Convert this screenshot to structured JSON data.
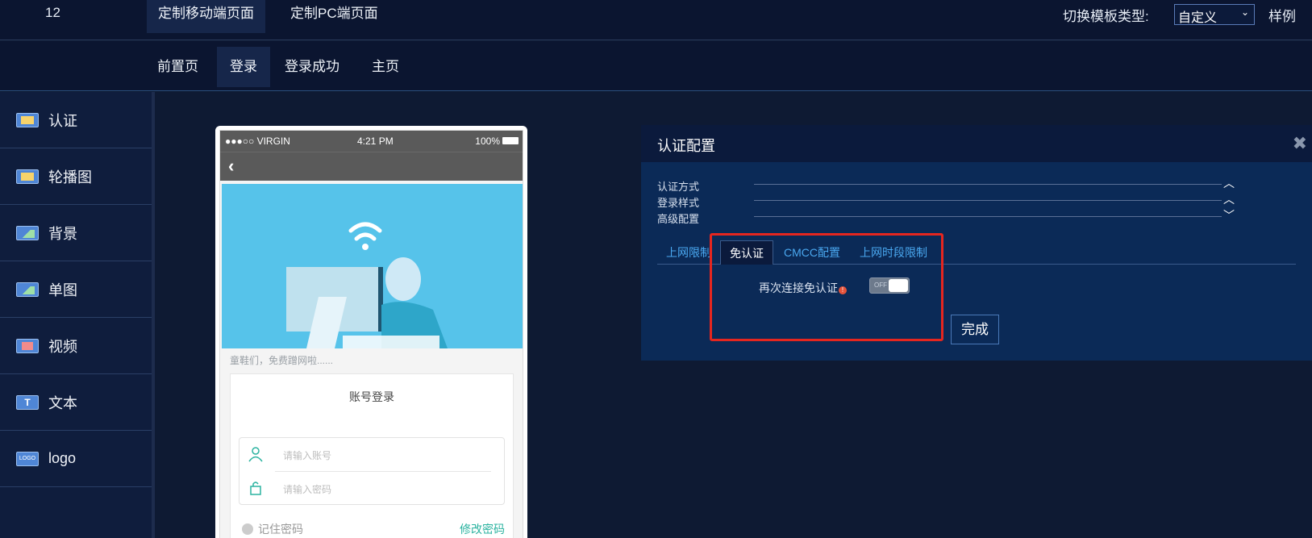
{
  "topbar": {
    "number": "12",
    "tabs": [
      "定制移动端页面",
      "定制PC端页面"
    ],
    "template_label": "切换模板类型:",
    "template_value": "自定义",
    "sample_label": "样例"
  },
  "subbar": {
    "tabs": [
      "前置页",
      "登录",
      "登录成功",
      "主页"
    ]
  },
  "sidebar": {
    "items": [
      {
        "label": "认证",
        "icon": "screen-icon"
      },
      {
        "label": "轮播图",
        "icon": "screen-icon"
      },
      {
        "label": "背景",
        "icon": "image-icon"
      },
      {
        "label": "单图",
        "icon": "image-icon"
      },
      {
        "label": "视频",
        "icon": "video-icon"
      },
      {
        "label": "文本",
        "icon": "text-icon",
        "glyph": "T"
      },
      {
        "label": "logo",
        "icon": "logo-icon",
        "glyph": "LOGO"
      }
    ]
  },
  "phone": {
    "carrier": "●●●○○ VIRGIN",
    "time": "4:21 PM",
    "battery": "100%",
    "back_glyph": "‹",
    "caption": "童鞋们，免费蹭网啦......",
    "login_title": "账号登录",
    "account_placeholder": "请输入账号",
    "password_placeholder": "请输入密码",
    "remember": "记住密码",
    "change_password": "修改密码"
  },
  "panel": {
    "title": "认证配置",
    "close_glyph": "✖",
    "rows": [
      {
        "label": "认证方式",
        "chevron": "︿"
      },
      {
        "label": "登录样式",
        "chevron": "︿"
      },
      {
        "label": "高级配置",
        "chevron": "﹀"
      }
    ],
    "tabs": [
      "上网限制",
      "免认证",
      "CMCC配置",
      "上网时段限制"
    ],
    "option_label": "再次连接免认证",
    "info_glyph": "!",
    "toggle_state": "OFF",
    "done_label": "完成"
  },
  "colors": {
    "background": "#0e1a33",
    "panel": "#0b2a57",
    "accent": "#4aa8f0",
    "highlight": "#e5261f",
    "banner": "#56c3ea"
  }
}
